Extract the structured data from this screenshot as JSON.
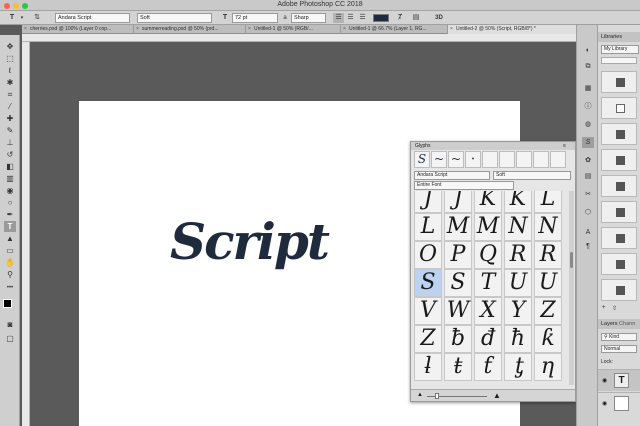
{
  "app": {
    "title": "Adobe Photoshop CC 2018"
  },
  "window_lights": [
    "#ff5f57",
    "#febc2e",
    "#28c840"
  ],
  "options_bar": {
    "tool_glyph": "T",
    "font_family": "Andara Script",
    "font_style": "Soft",
    "size_glyph": "T",
    "font_size": "72 pt",
    "aa_glyph": "a",
    "antialias": "Sharp",
    "text_color": "#1f2b3c",
    "mode_3d": "3D"
  },
  "tabs": [
    {
      "label": "cherries.psd @ 100% (Layer 0 cop..."
    },
    {
      "label": "summerreading.psd @ 50% (prd..."
    },
    {
      "label": "Untitled-1 @ 50% (RGB/..."
    },
    {
      "label": "Untitled-1 @ 66.7% (Layer 1, RG..."
    },
    {
      "label": "Untitled-2 @ 50% (Script, RGB/8*) *"
    }
  ],
  "canvas": {
    "text": "Script",
    "text_color": "#1f2b3c"
  },
  "glyphs_panel": {
    "title": "Glyphs",
    "recent_glyphs": [
      "S",
      "~",
      "~",
      "•"
    ],
    "font": "Andara Script",
    "style": "Soft",
    "filter": "Entire Font",
    "rows": [
      [
        "J",
        "J",
        "K",
        "K",
        "L"
      ],
      [
        "L",
        "M",
        "M",
        "N",
        "N"
      ],
      [
        "O",
        "P",
        "Q",
        "R",
        "R"
      ],
      [
        "S",
        "S",
        "T",
        "U",
        "U"
      ],
      [
        "V",
        "W",
        "X",
        "Y",
        "Z"
      ],
      [
        "Z",
        "ƀ",
        "đ",
        "ħ",
        "ƙ"
      ],
      [
        "ƚ",
        "ŧ",
        "ƭ",
        "ƫ",
        "ƞ"
      ]
    ],
    "selected_glyph": "S"
  },
  "right_panel": {
    "libraries_label": "Libraries",
    "library_name": "My Library",
    "layers_label": "Layers",
    "channels_label": "Chann",
    "kind": "Kind",
    "blend": "Normal",
    "lock": "Lock:"
  },
  "icons": {
    "move": "✥",
    "marquee": "⬚",
    "lasso": "ℓ",
    "wand": "✱",
    "crop": "⌗",
    "eyedropper": "⁄",
    "heal": "✚",
    "brush": "✎",
    "stamp": "⊥",
    "history": "↺",
    "eraser": "◧",
    "gradient": "▥",
    "blur": "◉",
    "dodge": "○",
    "pen": "✒",
    "type": "T",
    "path": "▲",
    "shape": "▭",
    "hand": "✋",
    "zoom": "⚲"
  }
}
